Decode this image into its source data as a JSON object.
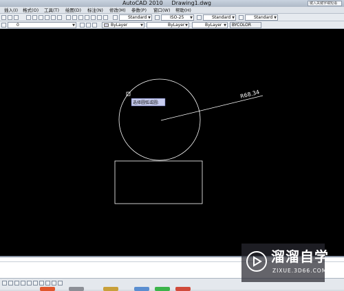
{
  "window": {
    "title": "AutoCAD 2010     Drawing1.dwg",
    "help_search_placeholder": "键入关键字或短语"
  },
  "menubar": {
    "items": [
      "插入(I)",
      "格式(O)",
      "工具(T)",
      "绘图(D)",
      "标注(N)",
      "修改(M)",
      "参数(P)",
      "窗口(W)",
      "帮助(H)"
    ]
  },
  "styles_toolbar": {
    "text_style": "Standard",
    "dim_style": "ISO-25",
    "table_style": "Standard",
    "multileader_style": "Standard"
  },
  "properties_toolbar": {
    "layer": "0",
    "color": "ByLayer",
    "linetype": "ByLayer",
    "lineweight": "ByLayer",
    "plot_style": "BYCOLOR"
  },
  "drawing": {
    "dimension_text": "R68.34",
    "tooltip": "选择圆弧或圆:"
  },
  "watermark": {
    "title": "溜溜自学",
    "subtitle": "ZIXUE.3D66.COM"
  },
  "colors": {
    "canvas": "#000000",
    "geometry": "#ffffff",
    "tooltip_bg": "#c8cdf0",
    "accent": "#3c78c8"
  }
}
